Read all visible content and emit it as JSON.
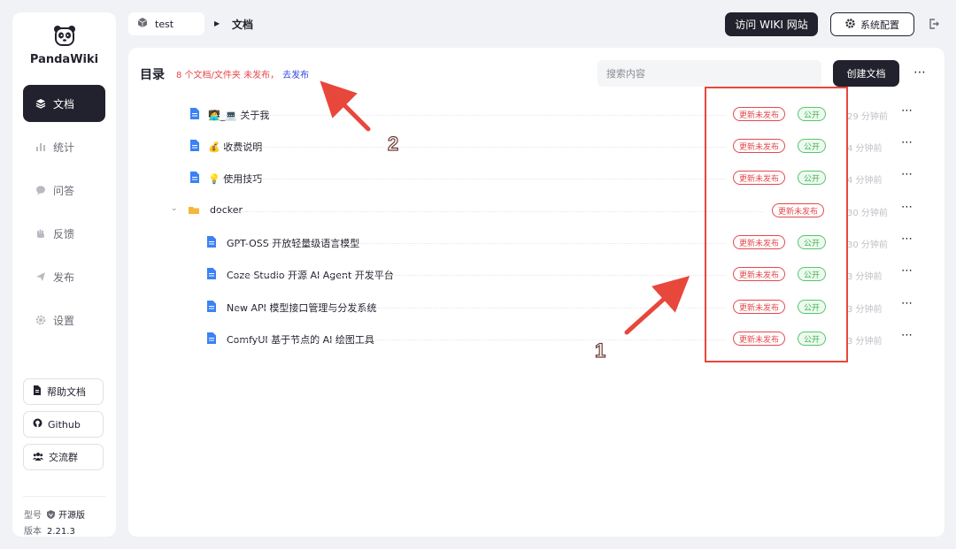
{
  "brand": {
    "name": "PandaWiki"
  },
  "sidebar": {
    "items": [
      {
        "label": "文档",
        "icon": "layers-icon",
        "active": true
      },
      {
        "label": "统计",
        "icon": "bar-chart-icon",
        "active": false
      },
      {
        "label": "问答",
        "icon": "chat-bubble-icon",
        "active": false
      },
      {
        "label": "反馈",
        "icon": "hand-icon",
        "active": false
      },
      {
        "label": "发布",
        "icon": "send-icon",
        "active": false
      },
      {
        "label": "设置",
        "icon": "gear-icon",
        "active": false
      }
    ],
    "links": [
      {
        "label": "帮助文档",
        "icon": "document-icon"
      },
      {
        "label": "Github",
        "icon": "github-icon"
      },
      {
        "label": "交流群",
        "icon": "group-icon"
      }
    ],
    "meta": {
      "model_label": "型号",
      "model_value": "开源版",
      "version_label": "版本",
      "version_value": "2.21.3"
    }
  },
  "header": {
    "project": "test",
    "breadcrumb_current": "文档",
    "visit_button": "访问 WIKI 网站",
    "config_button": "系统配置"
  },
  "main": {
    "title": "目录",
    "unpublished_notice": "8 个文档/文件夹 未发布，",
    "publish_link": "去发布",
    "search_placeholder": "搜索内容",
    "create_button": "创建文档",
    "rows": [
      {
        "title": "🧑‍💻_💻 关于我",
        "type": "doc",
        "depth": 0,
        "status": "更新未发布",
        "visibility": "公开",
        "time": "29 分钟前"
      },
      {
        "title": "💰 收费说明",
        "type": "doc",
        "depth": 0,
        "status": "更新未发布",
        "visibility": "公开",
        "time": "4 分钟前"
      },
      {
        "title": "💡 使用技巧",
        "type": "doc",
        "depth": 0,
        "status": "更新未发布",
        "visibility": "公开",
        "time": "4 分钟前"
      },
      {
        "title": "docker",
        "type": "folder",
        "depth": 0,
        "status": "更新未发布",
        "visibility": "",
        "time": "30 分钟前"
      },
      {
        "title": "GPT-OSS 开放轻量级语言模型",
        "type": "doc",
        "depth": 1,
        "status": "更新未发布",
        "visibility": "公开",
        "time": "30 分钟前"
      },
      {
        "title": "Coze Studio 开源 AI Agent 开发平台",
        "type": "doc",
        "depth": 1,
        "status": "更新未发布",
        "visibility": "公开",
        "time": "3 分钟前"
      },
      {
        "title": "New API 模型接口管理与分发系统",
        "type": "doc",
        "depth": 1,
        "status": "更新未发布",
        "visibility": "公开",
        "time": "3 分钟前"
      },
      {
        "title": "ComfyUI 基于节点的 AI 绘图工具",
        "type": "doc",
        "depth": 1,
        "status": "更新未发布",
        "visibility": "公开",
        "time": "3 分钟前"
      }
    ]
  },
  "annotations": {
    "label_1": "1",
    "label_2": "2",
    "color": "#e8473c"
  },
  "colors": {
    "primary": "#21222d",
    "danger": "#e5484d",
    "success": "#56c76a",
    "link": "#3248d9",
    "doc_icon": "#3b82f6",
    "folder_icon": "#f5b63c"
  }
}
